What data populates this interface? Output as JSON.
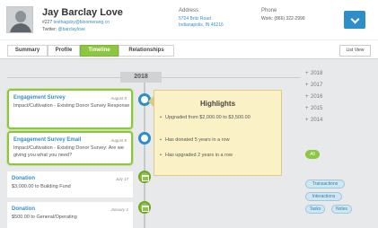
{
  "header": {
    "name": "Jay Barclay Love",
    "id_prefix": "#227",
    "email": "testhagsby@bloomerang.co",
    "twitter_label": "Twitter:",
    "twitter_handle": "@barclaylove",
    "address_label": "Address",
    "address_line1": "5724 Britz Road",
    "address_line2": "Indianapolis, IN 46216",
    "phone_label": "Phone",
    "phone_work": "Work: (866) 322-2999",
    "menu_icon": "chevron-down-icon"
  },
  "tabs": {
    "summary": "Summary",
    "profile": "Profile",
    "timeline": "Timeline",
    "relationships": "Relationships",
    "active": "Timeline",
    "list_view": "List View"
  },
  "timeline": {
    "year": "2018",
    "cards": [
      {
        "title": "Engagement Survey",
        "date": "August 8",
        "body": "Impact/Cultivation - Existing Donor Survey Response",
        "highlighted": true,
        "marker": "speech-bubble-icon"
      },
      {
        "title": "Engagement Survey Email",
        "date": "August 8",
        "body": "Impact/Cultivation - Existing Donor Survey: Are we giving you what you need?",
        "highlighted": true,
        "marker": "speech-bubble-icon"
      },
      {
        "title": "Donation",
        "date": "July 17",
        "body": "$3,000.00 to Building Fund",
        "highlighted": false,
        "marker": "gift-icon"
      },
      {
        "title": "Donation",
        "date": "January 1",
        "body": "$500.00 to General/Operating",
        "highlighted": false,
        "marker": "gift-icon"
      }
    ]
  },
  "highlights": {
    "title": "Highlights",
    "items": [
      "Upgraded from $2,000.00 to $3,500.00",
      "Has donated 5 years in a row",
      "Has upgraded 2 years in a row"
    ]
  },
  "filters": {
    "years": [
      "2018",
      "2017",
      "2016",
      "2015",
      "2014"
    ],
    "all": "All",
    "transactions": "Transactions",
    "interactions": "Interactions",
    "tasks": "Tasks",
    "notes": "Notes"
  },
  "colors": {
    "accent_green": "#8dc63f",
    "accent_blue": "#2d8ec9",
    "highlight_bg": "#faf2c6"
  }
}
